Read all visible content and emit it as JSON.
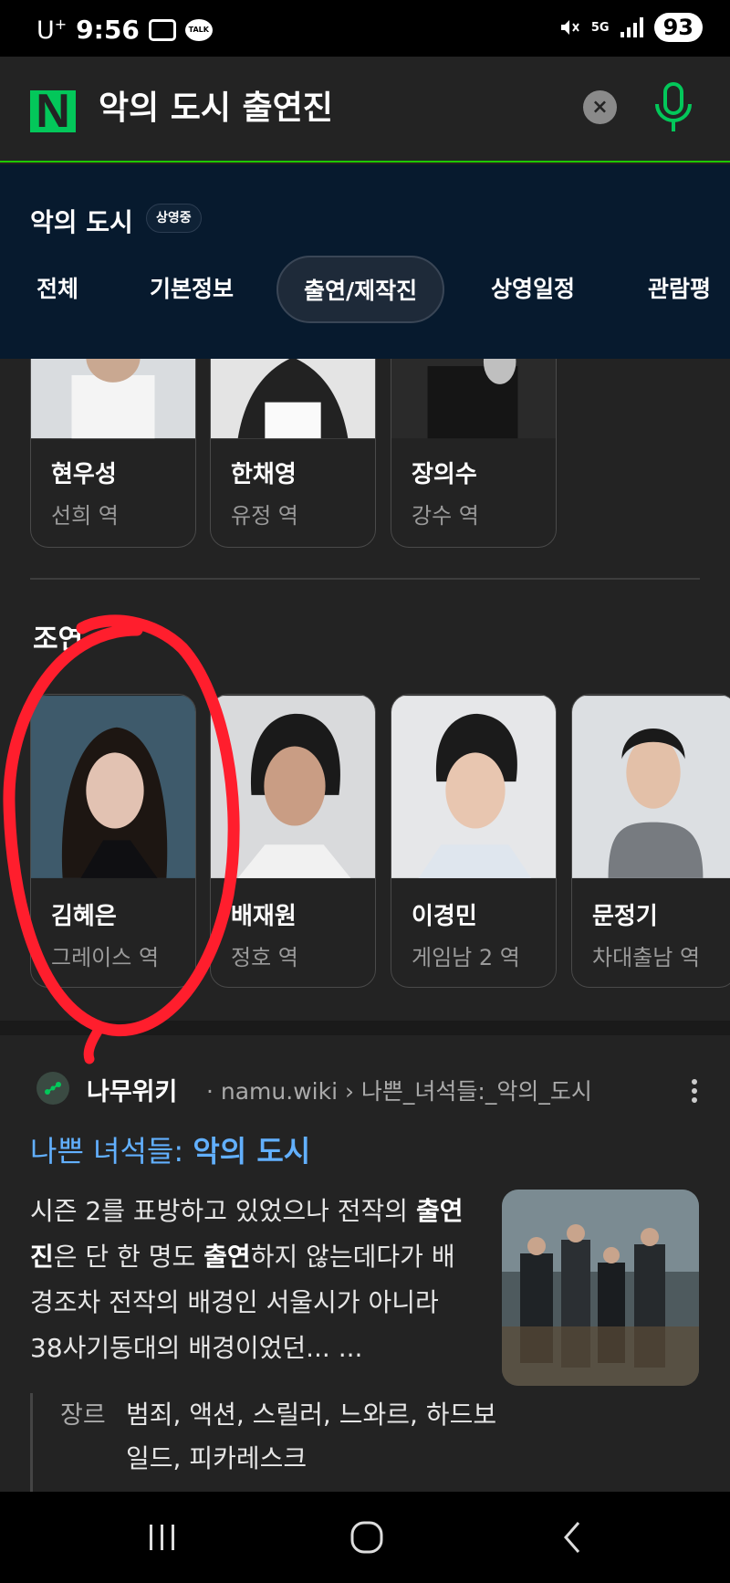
{
  "status_bar": {
    "carrier": "U",
    "carrier_sup": "+",
    "time": "9:56",
    "talk": "TALK",
    "network": "5G",
    "battery": "93"
  },
  "search": {
    "logo": "N",
    "query": "악의 도시 출연진",
    "clear_label": "×"
  },
  "movie": {
    "title": "악의 도시",
    "badge": "상영중",
    "tabs": [
      "전체",
      "기본정보",
      "출연/제작진",
      "상영일정",
      "관람평"
    ],
    "active_tab": "출연/제작진"
  },
  "cast_top": [
    {
      "name": "현우성",
      "role": "선희 역"
    },
    {
      "name": "한채영",
      "role": "유정 역"
    },
    {
      "name": "장의수",
      "role": "강수 역"
    }
  ],
  "section": {
    "title": "조연"
  },
  "cast_supporting": [
    {
      "name": "김혜은",
      "role": "그레이스 역"
    },
    {
      "name": "배재원",
      "role": "정호 역"
    },
    {
      "name": "이경민",
      "role": "게임남 2 역"
    },
    {
      "name": "문정기",
      "role": "차대출남 역"
    }
  ],
  "result": {
    "source_name": "나무위키",
    "source_url": "· namu.wiki › 나쁜_녀석들:_악의_도시",
    "title_prefix": "나쁜 녀석들: ",
    "title_highlight": "악의 도시",
    "snippet_1": "시즌 2를 표방하고 있었으나 전작의 ",
    "snippet_bold_1": "출연진",
    "snippet_2": "은 단 한 명도 ",
    "snippet_bold_2": "출연",
    "snippet_3": "하지 않는데다가 배경조차 전작의 배경인 서울시가 아니라 38사기동대의 배경이었던... ...",
    "meta_label": "장르",
    "meta_value": "범죄, 액션, 스릴러, 느와르, 하드보일드, 피카레스크"
  },
  "colors": {
    "naver_green": "#03c75a",
    "link_blue": "#62b0ff",
    "annotation_red": "#ff1e2d"
  }
}
